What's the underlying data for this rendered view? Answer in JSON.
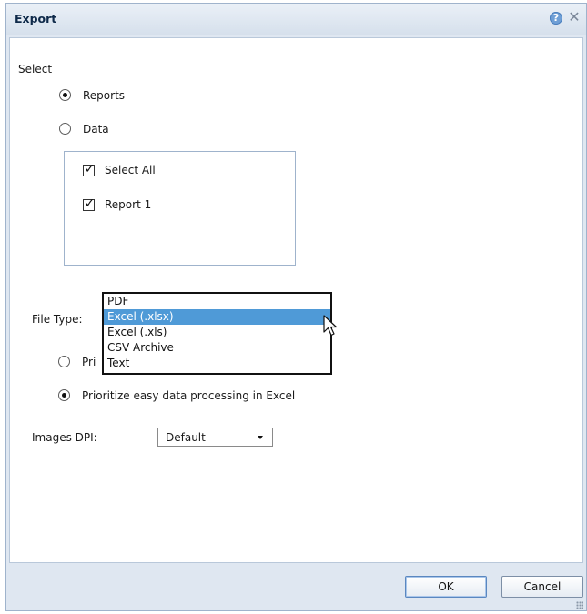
{
  "dialog": {
    "title": "Export",
    "help_icon": "help-icon",
    "close_icon": "close-icon"
  },
  "select_section": {
    "label": "Select",
    "options": [
      {
        "label": "Reports",
        "checked": true
      },
      {
        "label": "Data",
        "checked": false
      }
    ],
    "list_items": [
      {
        "label": "Select All",
        "checked": true
      },
      {
        "label": "Report 1",
        "checked": true
      }
    ]
  },
  "file_type": {
    "label": "File Type:",
    "options": [
      "PDF",
      "Excel (.xlsx)",
      "Excel (.xls)",
      "CSV Archive",
      "Text"
    ],
    "highlighted": "Excel (.xlsx)"
  },
  "processing": {
    "options": [
      {
        "label": "Prioritize format of report",
        "visible_text": "Pri",
        "checked": false
      },
      {
        "label": "Prioritize easy data processing in Excel",
        "checked": true
      }
    ]
  },
  "images_dpi": {
    "label": "Images DPI:",
    "value": "Default"
  },
  "footer": {
    "ok_label": "OK",
    "cancel_label": "Cancel"
  },
  "colors": {
    "accent": "#4f9ad7",
    "dialog_background": "#dfe7f1",
    "title_text": "#0f2a4a"
  }
}
